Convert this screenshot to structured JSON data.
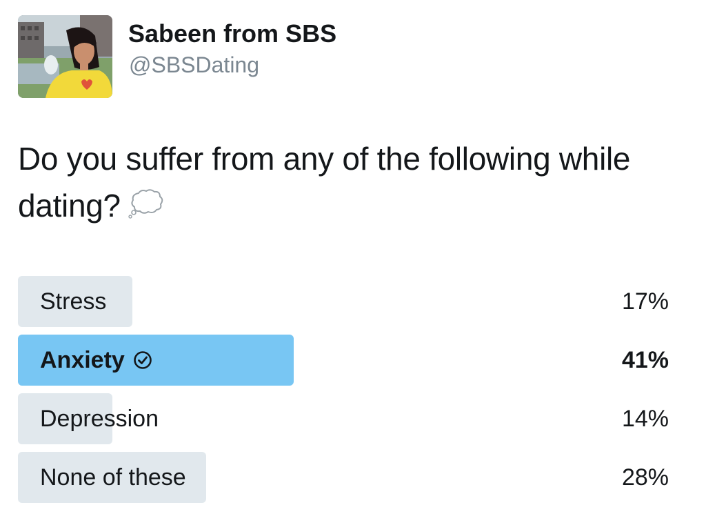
{
  "header": {
    "display_name": "Sabeen from SBS",
    "handle": "@SBSDating",
    "avatar_icon": "profile-photo"
  },
  "tweet": {
    "text": "Do you suffer from any of the following while dating?",
    "emoji_icon": "thought-balloon-icon"
  },
  "poll": {
    "options": [
      {
        "label": "Stress",
        "percent_text": "17%",
        "percent": 17,
        "winner": false
      },
      {
        "label": "Anxiety",
        "percent_text": "41%",
        "percent": 41,
        "winner": true,
        "icon": "check-circle-icon"
      },
      {
        "label": "Depression",
        "percent_text": "14%",
        "percent": 14,
        "winner": false
      },
      {
        "label": "None of these",
        "percent_text": "28%",
        "percent": 28,
        "winner": false
      }
    ]
  },
  "colors": {
    "bar_default": "#e1e8ed",
    "bar_winner": "#78c6f3",
    "text_primary": "#14171a",
    "text_secondary": "#7b8791"
  }
}
